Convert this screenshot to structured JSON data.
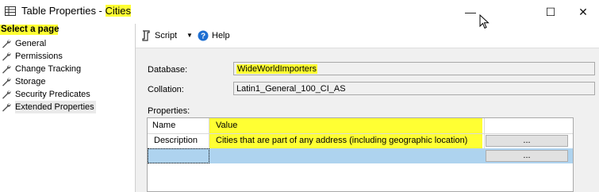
{
  "window": {
    "title_prefix": "Table Properties - ",
    "title_table": "Cities",
    "minimize_glyph": "—",
    "maximize_glyph": "☐",
    "close_glyph": "✕"
  },
  "sidebar": {
    "header": "Select a page",
    "items": [
      {
        "label": "General",
        "icon": "wrench-icon"
      },
      {
        "label": "Permissions",
        "icon": "wrench-icon"
      },
      {
        "label": "Change Tracking",
        "icon": "wrench-icon"
      },
      {
        "label": "Storage",
        "icon": "wrench-icon"
      },
      {
        "label": "Security Predicates",
        "icon": "wrench-icon"
      },
      {
        "label": "Extended Properties",
        "icon": "wrench-icon",
        "selected": true
      }
    ]
  },
  "toolbar": {
    "script_label": "Script",
    "help_label": "Help"
  },
  "form": {
    "database_label": "Database:",
    "database_value": "WideWorldImporters",
    "collation_label": "Collation:",
    "collation_value": "Latin1_General_100_CI_AS",
    "properties_label": "Properties:"
  },
  "grid": {
    "columns": [
      "Name",
      "Value"
    ],
    "rows": [
      {
        "name": "Description",
        "value": "Cities that are part of any address (including geographic location)",
        "button": "..."
      }
    ],
    "new_row_button": "..."
  },
  "colors": {
    "highlight": "#ffff33",
    "panel_bg": "#f0f0f0",
    "new_row_bg": "#aed3ef",
    "help_icon": "#1f6fd1"
  }
}
